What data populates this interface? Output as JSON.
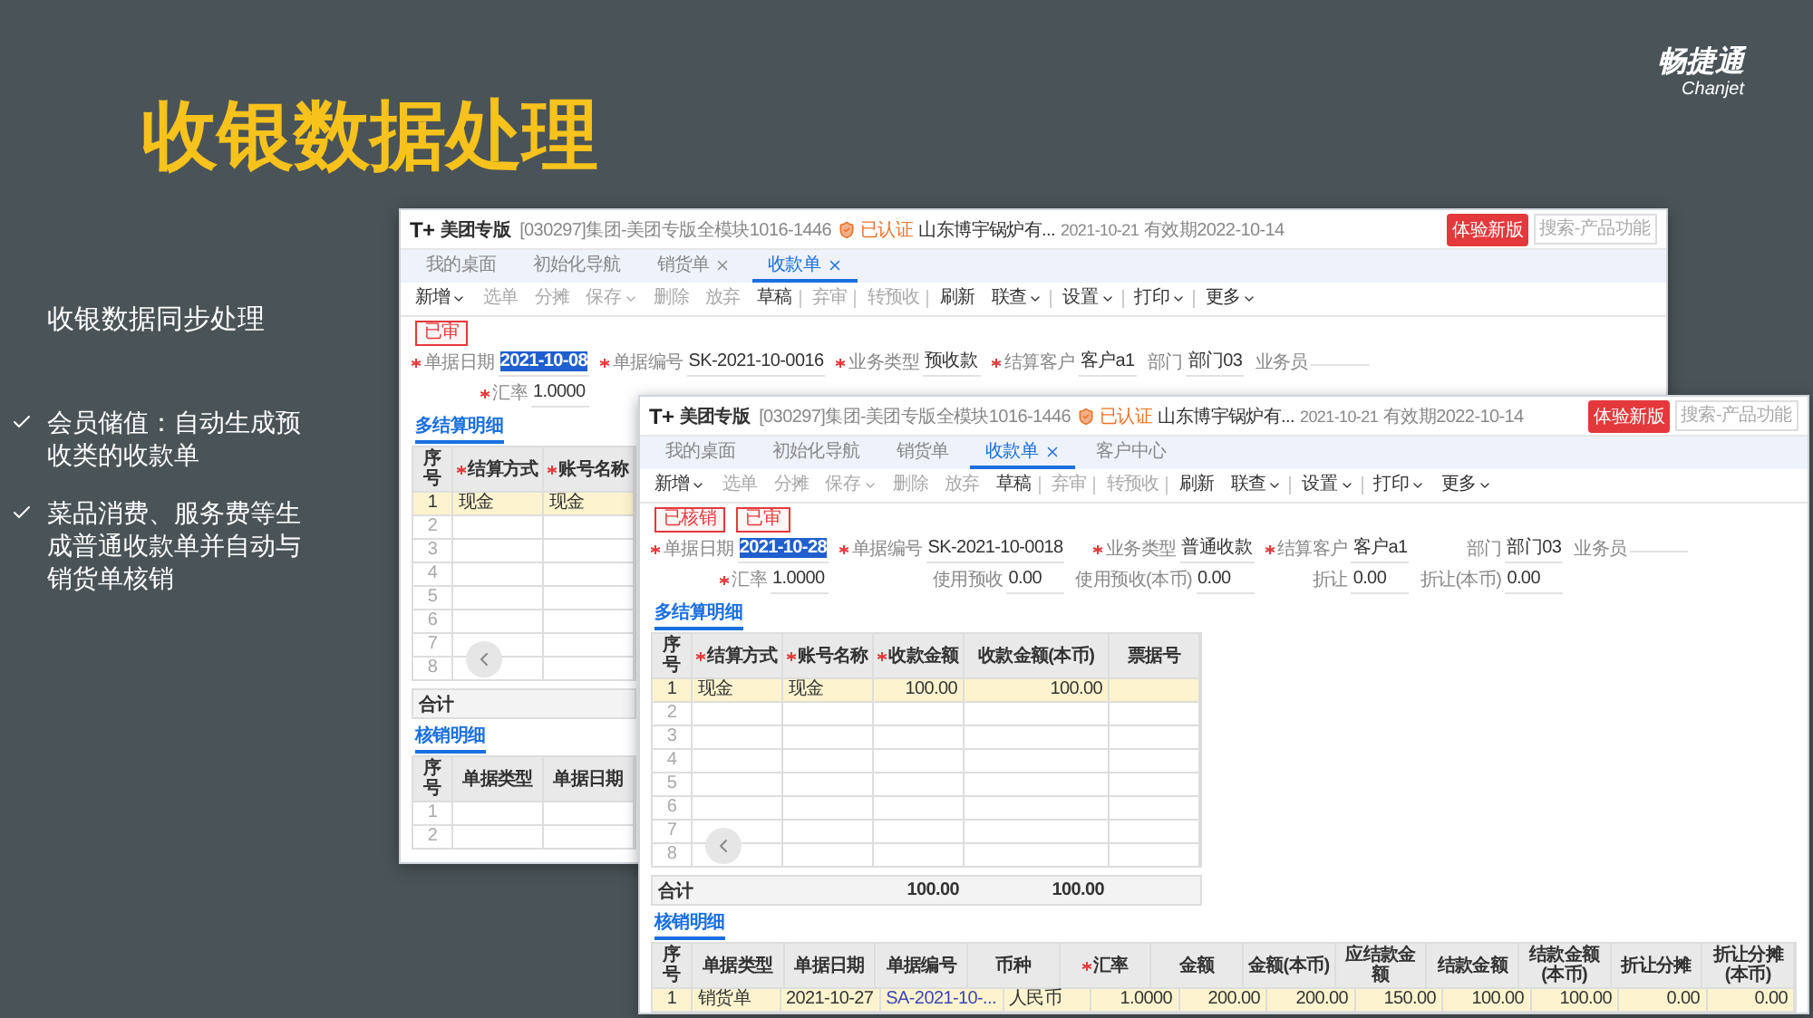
{
  "slide": {
    "title": "收银数据处理",
    "logo": {
      "name": "畅捷通",
      "latin": "Chanjet"
    },
    "summary": {
      "heading": "收银数据同步处理",
      "bullets": [
        "会员储值：自动生成预收类的收款单",
        "菜品消费、服务费等生成普通收款单并自动与销货单核销"
      ]
    }
  },
  "windows": [
    {
      "logo": "T+",
      "brand": "美团专版",
      "account": "[030297]集团-美团专版全模块1016-1446",
      "certified": "已认证",
      "company": "山东博宇锅炉有...",
      "date": "2021-10-21",
      "validity": "有效期2022-10-14",
      "trial_button": "体验新版",
      "search": {
        "placeholder": "搜索-产品功能"
      },
      "tabs": [
        {
          "label": "我的桌面",
          "selected": false,
          "closable": false
        },
        {
          "label": "初始化导航",
          "selected": false,
          "closable": false
        },
        {
          "label": "销货单",
          "selected": false,
          "closable": true
        },
        {
          "label": "收款单",
          "selected": true,
          "closable": true
        }
      ],
      "toolbar": [
        {
          "label": "新增",
          "dropdown": true,
          "disabled": false,
          "separator_after": false
        },
        {
          "label": "选单",
          "dropdown": false,
          "disabled": true,
          "separator_after": false
        },
        {
          "label": "分摊",
          "dropdown": false,
          "disabled": true,
          "separator_after": false
        },
        {
          "label": "保存",
          "dropdown": true,
          "disabled": true,
          "separator_after": false
        },
        {
          "label": "删除",
          "dropdown": false,
          "disabled": true,
          "separator_after": false
        },
        {
          "label": "放弃",
          "dropdown": false,
          "disabled": true,
          "separator_after": false
        },
        {
          "label": "草稿",
          "dropdown": false,
          "disabled": false,
          "separator_after": true
        },
        {
          "label": "弃审",
          "dropdown": false,
          "disabled": true,
          "separator_after": true
        },
        {
          "label": "转预收",
          "dropdown": false,
          "disabled": true,
          "separator_after": true
        },
        {
          "label": "刷新",
          "dropdown": false,
          "disabled": false,
          "separator_after": false
        },
        {
          "label": "联查",
          "dropdown": true,
          "disabled": false,
          "separator_after": true
        },
        {
          "label": "设置",
          "dropdown": true,
          "disabled": false,
          "separator_after": true
        },
        {
          "label": "打印",
          "dropdown": true,
          "disabled": false,
          "separator_after": true
        },
        {
          "label": "更多",
          "dropdown": true,
          "disabled": false,
          "separator_after": false
        }
      ],
      "stamps": [
        "已审"
      ],
      "field_rows": [
        [
          {
            "label": "单据日期",
            "value": "2021-10-08",
            "required": true,
            "highlighted": true
          },
          {
            "label": "单据编号",
            "value": "SK-2021-10-0016",
            "required": true,
            "highlighted": false
          },
          {
            "label": "业务类型",
            "value": "预收款",
            "required": true,
            "highlighted": false
          },
          {
            "label": "结算客户",
            "value": "客户a1",
            "required": true,
            "highlighted": false
          },
          {
            "label": "部门",
            "value": "部门03",
            "required": false,
            "highlighted": false
          },
          {
            "label": "业务员",
            "required": false
          }
        ],
        [
          {
            "label": "汇率",
            "value": "1.0000",
            "required": true,
            "highlighted": false
          }
        ]
      ],
      "sections": [
        {
          "title": "多结算明细",
          "columns": [
            {
              "label": "序号",
              "kind": "index",
              "required": false
            },
            {
              "label": "结算方式",
              "kind": "text",
              "required": true
            },
            {
              "label": "账号名称",
              "kind": "text",
              "required": true
            }
          ],
          "rows": [
            {
              "cells": [
                "1",
                "现金",
                "现金"
              ],
              "selected": true
            },
            {
              "cells": [
                "2"
              ],
              "selected": false
            },
            {
              "cells": [
                "3"
              ],
              "selected": false
            },
            {
              "cells": [
                "4"
              ],
              "selected": false
            },
            {
              "cells": [
                "5"
              ],
              "selected": false
            },
            {
              "cells": [
                "6"
              ],
              "selected": false
            },
            {
              "cells": [
                "7"
              ],
              "selected": false
            },
            {
              "cells": [
                "8"
              ],
              "selected": false
            }
          ],
          "scroll_button": true,
          "total": {
            "label": "合计"
          }
        },
        {
          "title": "核销明细",
          "columns": [
            {
              "label": "序号",
              "kind": "index",
              "required": false
            },
            {
              "label": "单据类型",
              "kind": "text",
              "required": false
            },
            {
              "label": "单据日期",
              "kind": "text",
              "required": false
            }
          ],
          "rows": [
            {
              "cells": [
                "1"
              ],
              "selected": false
            },
            {
              "cells": [
                "2"
              ],
              "selected": false
            }
          ]
        }
      ]
    },
    {
      "logo": "T+",
      "brand": "美团专版",
      "account": "[030297]集团-美团专版全模块1016-1446",
      "certified": "已认证",
      "company": "山东博宇锅炉有...",
      "date": "2021-10-21",
      "validity": "有效期2022-10-14",
      "trial_button": "体验新版",
      "search": {
        "placeholder": "搜索-产品功能"
      },
      "tabs": [
        {
          "label": "我的桌面",
          "selected": false,
          "closable": false
        },
        {
          "label": "初始化导航",
          "selected": false,
          "closable": false
        },
        {
          "label": "销货单",
          "selected": false,
          "closable": false
        },
        {
          "label": "收款单",
          "selected": true,
          "closable": true
        },
        {
          "label": "客户中心",
          "selected": false,
          "closable": false
        }
      ],
      "toolbar": [
        {
          "label": "新增",
          "dropdown": true,
          "disabled": false,
          "separator_after": false
        },
        {
          "label": "选单",
          "dropdown": false,
          "disabled": true,
          "separator_after": false
        },
        {
          "label": "分摊",
          "dropdown": false,
          "disabled": true,
          "separator_after": false
        },
        {
          "label": "保存",
          "dropdown": true,
          "disabled": true,
          "separator_after": false
        },
        {
          "label": "删除",
          "dropdown": false,
          "disabled": true,
          "separator_after": false
        },
        {
          "label": "放弃",
          "dropdown": false,
          "disabled": true,
          "separator_after": false
        },
        {
          "label": "草稿",
          "dropdown": false,
          "disabled": false,
          "separator_after": true
        },
        {
          "label": "弃审",
          "dropdown": false,
          "disabled": true,
          "separator_after": true
        },
        {
          "label": "转预收",
          "dropdown": false,
          "disabled": true,
          "separator_after": true
        },
        {
          "label": "刷新",
          "dropdown": false,
          "disabled": false,
          "separator_after": false
        },
        {
          "label": "联查",
          "dropdown": true,
          "disabled": false,
          "separator_after": true
        },
        {
          "label": "设置",
          "dropdown": true,
          "disabled": false,
          "separator_after": true
        },
        {
          "label": "打印",
          "dropdown": true,
          "disabled": false,
          "separator_after": false
        },
        {
          "label": "更多",
          "dropdown": true,
          "disabled": false,
          "separator_after": false
        }
      ],
      "stamps": [
        "已核销",
        "已审"
      ],
      "field_rows": [
        [
          {
            "label": "单据日期",
            "value": "2021-10-28",
            "required": true,
            "highlighted": true
          },
          {
            "label": "单据编号",
            "value": "SK-2021-10-0018",
            "required": true,
            "highlighted": false
          },
          {
            "label": "业务类型",
            "value": "普通收款",
            "required": true,
            "highlighted": false
          },
          {
            "label": "结算客户",
            "value": "客户a1",
            "required": true,
            "highlighted": false
          },
          {
            "label": "部门",
            "value": "部门03",
            "required": false,
            "highlighted": false
          },
          {
            "label": "业务员",
            "required": false
          }
        ],
        [
          {
            "label": "汇率",
            "value": "1.0000",
            "required": true,
            "highlighted": false
          },
          {
            "label": "使用预收",
            "value": "0.00",
            "required": false,
            "highlighted": false
          },
          {
            "label": "使用预收(本币)",
            "value": "0.00",
            "required": false,
            "highlighted": false
          },
          {
            "label": "折让",
            "value": "0.00",
            "required": false,
            "highlighted": false
          },
          {
            "label": "折让(本币)",
            "value": "0.00",
            "required": false,
            "highlighted": false
          }
        ]
      ],
      "sections": [
        {
          "title": "多结算明细",
          "columns": [
            {
              "label": "序号",
              "kind": "index",
              "required": false
            },
            {
              "label": "结算方式",
              "kind": "text",
              "required": true
            },
            {
              "label": "账号名称",
              "kind": "text",
              "required": true
            },
            {
              "label": "收款金额",
              "kind": "amount",
              "required": true
            },
            {
              "label": "收款金额(本币)",
              "kind": "amount",
              "required": false
            },
            {
              "label": "票据号",
              "kind": "text",
              "required": false
            }
          ],
          "rows": [
            {
              "cells": [
                "1",
                "现金",
                "现金",
                "100.00",
                "100.00"
              ],
              "selected": true
            },
            {
              "cells": [
                "2"
              ],
              "selected": false
            },
            {
              "cells": [
                "3"
              ],
              "selected": false
            },
            {
              "cells": [
                "4"
              ],
              "selected": false
            },
            {
              "cells": [
                "5"
              ],
              "selected": false
            },
            {
              "cells": [
                "6"
              ],
              "selected": false
            },
            {
              "cells": [
                "7"
              ],
              "selected": false
            },
            {
              "cells": [
                "8"
              ],
              "selected": false
            }
          ],
          "scroll_button": true,
          "total": {
            "label": "合计",
            "values": [
              "100.00",
              "100.00"
            ]
          }
        },
        {
          "title": "核销明细",
          "columns": [
            {
              "label": "序号",
              "kind": "index",
              "required": false
            },
            {
              "label": "单据类型",
              "kind": "text",
              "required": false
            },
            {
              "label": "单据日期",
              "kind": "text",
              "required": false
            },
            {
              "label": "单据编号",
              "kind": "link",
              "required": false
            },
            {
              "label": "币种",
              "kind": "text",
              "required": false
            },
            {
              "label": "汇率",
              "kind": "amount",
              "required": true
            },
            {
              "label": "金额",
              "kind": "amount",
              "required": false
            },
            {
              "label": "金额(本币)",
              "kind": "amount",
              "required": false
            },
            {
              "label": "应结款金额",
              "kind": "amount",
              "required": false
            },
            {
              "label": "结款金额",
              "kind": "amount",
              "required": false
            },
            {
              "label": "结款金额(本币)",
              "kind": "amount",
              "required": false
            },
            {
              "label": "折让分摊",
              "kind": "amount",
              "required": false
            },
            {
              "label": "折让分摊(本币)",
              "kind": "amount",
              "required": false
            }
          ],
          "rows": [
            {
              "cells": [
                "1",
                "销货单",
                "2021-10-27",
                "SA-2021-10-...",
                "人民币",
                "1.0000",
                "200.00",
                "200.00",
                "150.00",
                "100.00",
                "100.00",
                "0.00",
                "0.00"
              ],
              "selected": true
            }
          ]
        }
      ]
    }
  ]
}
